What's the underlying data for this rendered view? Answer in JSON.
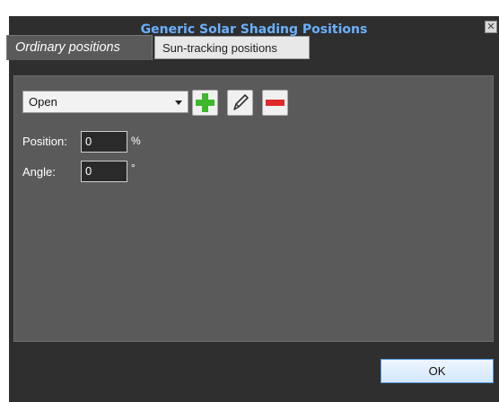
{
  "window": {
    "title": "Generic Solar Shading Positions",
    "close_icon": "close-icon"
  },
  "tabs": [
    {
      "label": "Ordinary positions",
      "active": true
    },
    {
      "label": "Sun-tracking positions",
      "active": false
    }
  ],
  "position_select": {
    "selected": "Open",
    "icon": "chevron-down-icon"
  },
  "toolbar": {
    "add_icon": "plus-icon",
    "edit_icon": "pencil-icon",
    "remove_icon": "minus-icon"
  },
  "fields": {
    "position": {
      "label": "Position:",
      "value": "0",
      "unit": "%"
    },
    "angle": {
      "label": "Angle:",
      "value": "0",
      "unit": "°"
    }
  },
  "footer": {
    "ok_label": "OK"
  },
  "colors": {
    "title_accent": "#6ab0ff",
    "add_green": "#3cb82c",
    "remove_red": "#e02a2a",
    "ok_border": "#5aa0e6"
  }
}
